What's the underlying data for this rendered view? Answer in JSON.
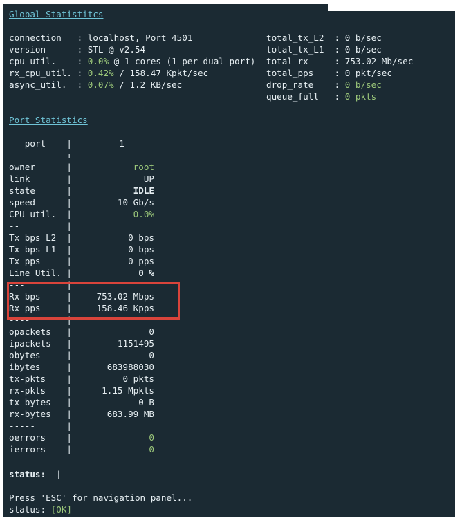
{
  "global": {
    "header": "Global Statistitcs",
    "connection_label": "connection   : ",
    "connection_value": "localhost, Port 4501",
    "version_label": "version      : ",
    "version_value": "STL @ v2.54",
    "cpu_util_label": "cpu_util.    : ",
    "cpu_util_pct": "0.0%",
    "cpu_util_rest": " @ 1 cores (1 per dual port)",
    "rx_cpu_label": "rx_cpu_util. : ",
    "rx_cpu_pct": "0.42%",
    "rx_cpu_rest": " / 158.47 Kpkt/sec",
    "async_label": "async_util.  : ",
    "async_pct": "0.07%",
    "async_rest": " / 1.2 KB/sec",
    "total_tx_l2_label": "total_tx_L2  : ",
    "total_tx_l2_value": "0 b/sec",
    "total_tx_l1_label": "total_tx_L1  : ",
    "total_tx_l1_value": "0 b/sec",
    "total_rx_label": "total_rx     : ",
    "total_rx_value": "753.02 Mb/sec",
    "total_pps_label": "total_pps    : ",
    "total_pps_value": "0 pkt/sec",
    "drop_rate_label": "drop_rate    : ",
    "drop_rate_value": "0 b/sec",
    "queue_full_label": "queue_full   : ",
    "queue_full_value": "0 pkts"
  },
  "port": {
    "header": "Port Statistics",
    "head_row": "   port    |         1",
    "separator": "-----------+------------------",
    "rows": [
      {
        "key": "owner      |",
        "val": "root",
        "cls": "gr"
      },
      {
        "key": "link       |",
        "val": "UP",
        "cls": ""
      },
      {
        "key": "state      |",
        "val": "IDLE",
        "cls": "b"
      },
      {
        "key": "speed      |",
        "val": "10 Gb/s",
        "cls": ""
      },
      {
        "key": "CPU util.  |",
        "val": "0.0%",
        "cls": "gr"
      },
      {
        "key": "--         |",
        "val": "",
        "cls": ""
      },
      {
        "key": "Tx bps L2  |",
        "val": "0 bps",
        "cls": ""
      },
      {
        "key": "Tx bps L1  |",
        "val": "0 bps",
        "cls": ""
      },
      {
        "key": "Tx pps     |",
        "val": "0 pps",
        "cls": ""
      },
      {
        "key": "Line Util. |",
        "val": "0 %",
        "cls": "b"
      },
      {
        "key": "---        |",
        "val": "",
        "cls": ""
      },
      {
        "key": "Rx bps     |",
        "val": "753.02 Mbps",
        "cls": ""
      },
      {
        "key": "Rx pps     |",
        "val": "158.46 Kpps",
        "cls": ""
      },
      {
        "key": "----       |",
        "val": "",
        "cls": ""
      },
      {
        "key": "opackets   |",
        "val": "0",
        "cls": ""
      },
      {
        "key": "ipackets   |",
        "val": "1151495",
        "cls": ""
      },
      {
        "key": "obytes     |",
        "val": "0",
        "cls": ""
      },
      {
        "key": "ibytes     |",
        "val": "683988030",
        "cls": ""
      },
      {
        "key": "tx-pkts    |",
        "val": "0 pkts",
        "cls": ""
      },
      {
        "key": "rx-pkts    |",
        "val": "1.15 Mpkts",
        "cls": ""
      },
      {
        "key": "tx-bytes   |",
        "val": "0 B",
        "cls": ""
      },
      {
        "key": "rx-bytes   |",
        "val": "683.99 MB",
        "cls": ""
      },
      {
        "key": "-----      |",
        "val": "",
        "cls": ""
      },
      {
        "key": "oerrors    |",
        "val": "0",
        "cls": "gr"
      },
      {
        "key": "ierrors    |",
        "val": "0",
        "cls": "gr"
      }
    ]
  },
  "footer": {
    "status_line": "status:  |",
    "press_esc": "Press 'ESC' for navigation panel...",
    "status_label": "status: ",
    "status_value": "[OK]"
  }
}
